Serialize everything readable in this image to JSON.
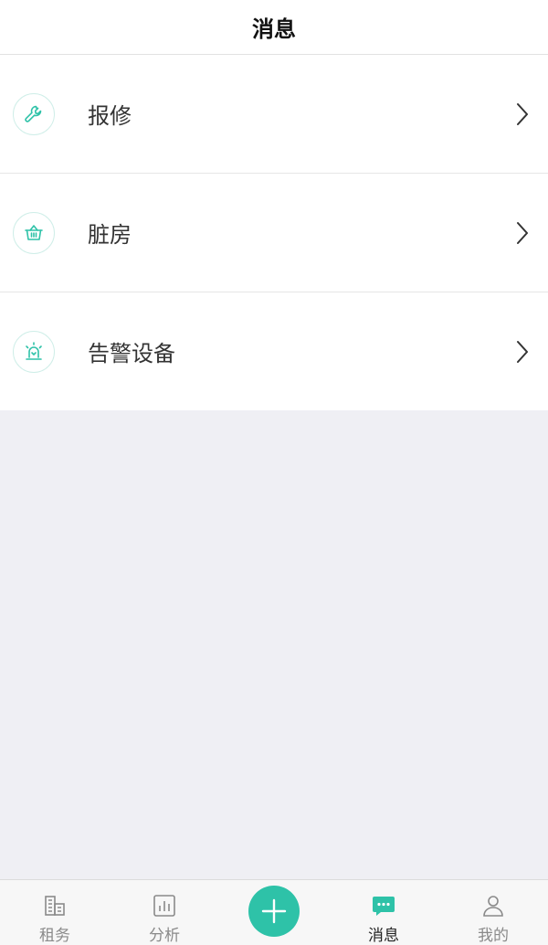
{
  "header": {
    "title": "消息"
  },
  "messages": {
    "items": [
      {
        "label": "报修",
        "icon": "wrench-icon"
      },
      {
        "label": "脏房",
        "icon": "basket-icon"
      },
      {
        "label": "告警设备",
        "icon": "alarm-light-icon"
      }
    ]
  },
  "tabbar": {
    "items": [
      {
        "label": "租务",
        "icon": "building-icon",
        "active": false
      },
      {
        "label": "分析",
        "icon": "bar-chart-icon",
        "active": false
      },
      {
        "label": "消息",
        "icon": "message-icon",
        "active": true
      },
      {
        "label": "我的",
        "icon": "user-icon",
        "active": false
      }
    ],
    "add_icon": "plus-icon"
  },
  "colors": {
    "accent": "#2ec2a8",
    "background": "#efeff4"
  }
}
